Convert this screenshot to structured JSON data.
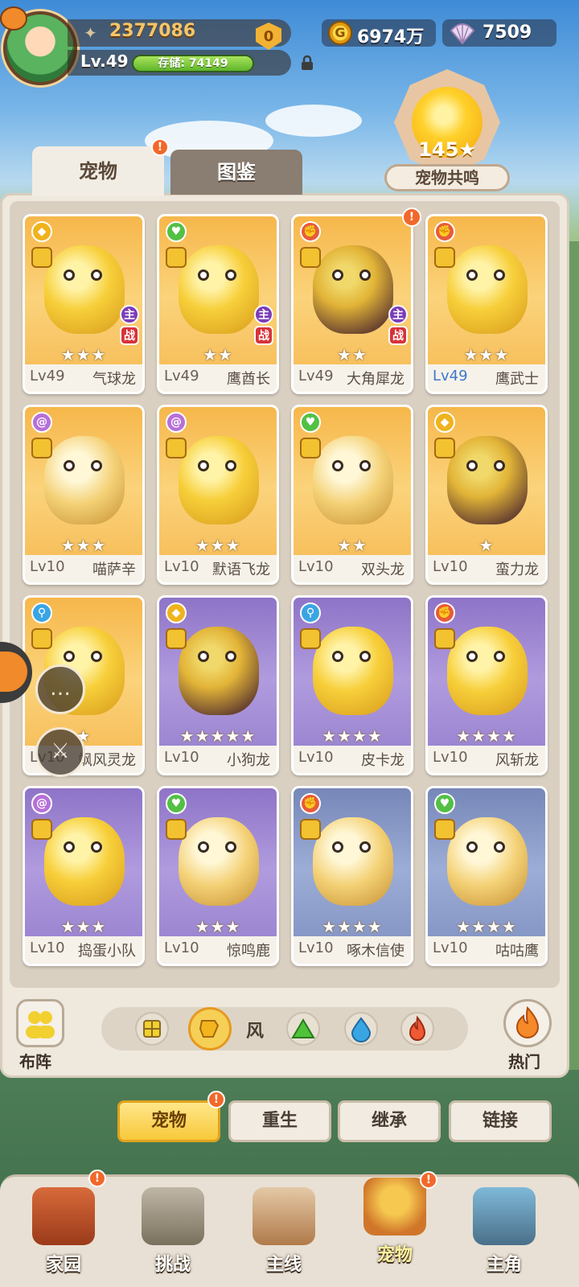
{
  "player": {
    "power": "2377086",
    "level": "Lv.49",
    "storage": "存储: 74149"
  },
  "currency": {
    "gold": "6974万",
    "shells": "7509"
  },
  "resonance": {
    "value": "145",
    "label": "宠物共鸣"
  },
  "tabs": {
    "pets": "宠物",
    "codex": "图鉴"
  },
  "alert_mark": "!",
  "pets": [
    {
      "level": "Lv49",
      "name": "气球龙",
      "element": "shield",
      "stars": "★★★",
      "theme": "gold",
      "main": "主",
      "battle": "战"
    },
    {
      "level": "Lv49",
      "name": "鹰酋长",
      "element": "heart",
      "stars": "★★",
      "theme": "gold",
      "main": "主",
      "battle": "战"
    },
    {
      "level": "Lv49",
      "name": "大角犀龙",
      "element": "fist",
      "stars": "★★",
      "theme": "gold",
      "main": "主",
      "battle": "战"
    },
    {
      "level": "Lv49",
      "name": "鹰武士",
      "element": "fist",
      "stars": "★★★",
      "theme": "gold"
    },
    {
      "level": "Lv10",
      "name": "喵萨辛",
      "element": "spiral",
      "stars": "★★★",
      "theme": "gold"
    },
    {
      "level": "Lv10",
      "name": "默语飞龙",
      "element": "spiral",
      "stars": "★★★",
      "theme": "gold"
    },
    {
      "level": "Lv10",
      "name": "双头龙",
      "element": "heart",
      "stars": "★★",
      "theme": "gold"
    },
    {
      "level": "Lv10",
      "name": "蛮力龙",
      "element": "shield",
      "stars": "★",
      "theme": "gold"
    },
    {
      "level": "Lv10",
      "name": "飒风灵龙",
      "element": "key",
      "stars": "★",
      "theme": "gold"
    },
    {
      "level": "Lv10",
      "name": "小狗龙",
      "element": "shield",
      "stars": "★★★★★",
      "theme": "purple"
    },
    {
      "level": "Lv10",
      "name": "皮卡龙",
      "element": "key",
      "stars": "★★★★",
      "theme": "purple"
    },
    {
      "level": "Lv10",
      "name": "风斩龙",
      "element": "fist",
      "stars": "★★★★",
      "theme": "purple"
    },
    {
      "level": "Lv10",
      "name": "捣蛋小队",
      "element": "spiral",
      "stars": "★★★",
      "theme": "purple"
    },
    {
      "level": "Lv10",
      "name": "惊鸣鹿",
      "element": "heart",
      "stars": "★★★",
      "theme": "purple"
    },
    {
      "level": "Lv10",
      "name": "啄木信使",
      "element": "fist",
      "stars": "★★★★",
      "theme": "blue"
    },
    {
      "level": "Lv10",
      "name": "咕咕鹰",
      "element": "heart",
      "stars": "★★★★",
      "theme": "blue"
    }
  ],
  "controls": {
    "team": "布阵",
    "hot": "热门",
    "filter_selected": "风"
  },
  "actions": [
    "宠物",
    "重生",
    "继承",
    "链接"
  ],
  "nav": [
    "家园",
    "挑战",
    "主线",
    "宠物",
    "主角"
  ]
}
